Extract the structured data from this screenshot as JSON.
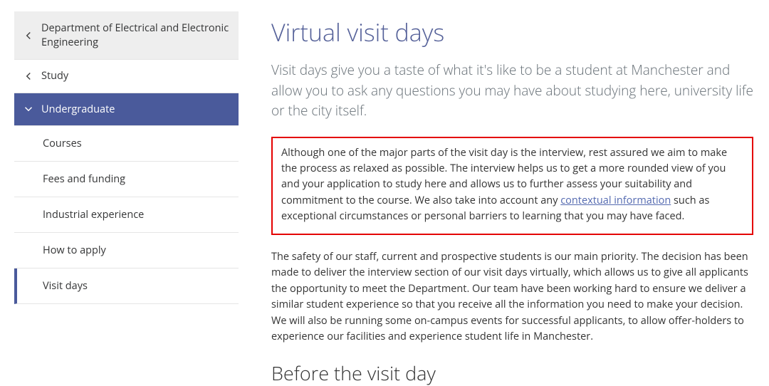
{
  "sidebar": {
    "parent": {
      "label": "Department of Electrical and Electronic Engineering"
    },
    "study": {
      "label": "Study"
    },
    "active": {
      "label": "Undergraduate"
    },
    "items": [
      {
        "label": "Courses"
      },
      {
        "label": "Fees and funding"
      },
      {
        "label": "Industrial experience"
      },
      {
        "label": "How to apply"
      },
      {
        "label": "Visit days"
      }
    ]
  },
  "page": {
    "title": "Virtual visit days",
    "intro": "Visit days give you a taste of what it's like to be a student at Manchester and allow you to ask any questions you may have about studying here, university life or the city itself.",
    "highlight_pre": "Although one of the major parts of the visit day is the interview, rest assured we aim to make the process as relaxed as possible. The interview helps us to get a more rounded view of you and your application to study here and allows us to further assess your suitability and commitment to the course. We also take into account any ",
    "highlight_link": "contextual information",
    "highlight_post": " such as exceptional circumstances or personal barriers to learning that you may have faced.",
    "para2": "The safety of our staff, current and prospective students is our main priority. The decision has been made to deliver the interview section of our visit days virtually, which allows us to give all applicants the opportunity to meet the Department. Our team have been working hard to ensure we deliver a similar student experience so that you receive all the information you need to make your decision. We will also be running some on-campus events for successful applicants, to allow offer-holders to experience our facilities and experience student life in Manchester.",
    "subhead": "Before the visit day"
  }
}
